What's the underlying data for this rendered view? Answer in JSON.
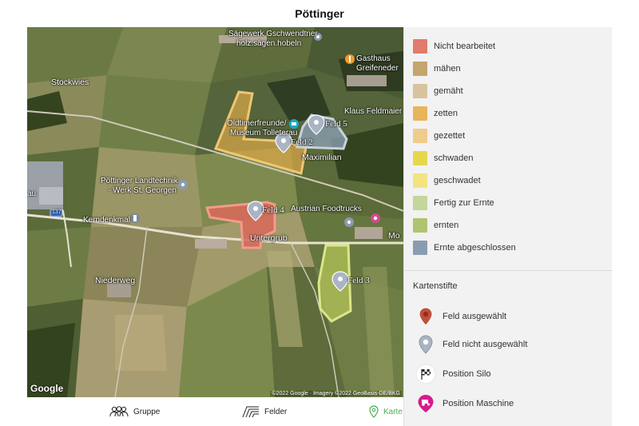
{
  "header": {
    "title": "Pöttinger"
  },
  "map": {
    "labels": {
      "stockwies": "Stockwies",
      "sagewerk_line1": "Sägewerk Gschwendtner",
      "sagewerk_line2": "holz.sägen.hobeln",
      "gasthaus_line1": "Gasthaus",
      "gasthaus_line2": "Greifeneder",
      "klaus": "Klaus Feldmaier",
      "oldtimer_line1": "Oldtimerfreunde/",
      "oldtimer_line2": "Museum Tolleterau",
      "maximilian": "Maximilian",
      "landtechnik_line1": "Pöttinger Landtechnik",
      "landtechnik_line2": "- Werk St. Georgen",
      "kerndenkmal": "Kerndenkmal",
      "austrian": "Austrian Foodtrucks",
      "untergrub": "Untergrub",
      "niederweg": "Niederweg",
      "mo": "Mo",
      "road_137": "137",
      "au": "au"
    },
    "fields": {
      "feld2": "Feld 2",
      "feld3": "Feld 3",
      "feld4": "Feld 4",
      "feld5": "Feld 5"
    },
    "google": "Google",
    "copyright": "©2022 Google · Imagery ©2022 GeoBasis-DE/BKG"
  },
  "legend": {
    "items": [
      {
        "label": "Nicht bearbeitet",
        "color": "#e07b6e"
      },
      {
        "label": "mähen",
        "color": "#c4a66c"
      },
      {
        "label": "gemäht",
        "color": "#d8c49c"
      },
      {
        "label": "zetten",
        "color": "#e8b55a"
      },
      {
        "label": "gezettet",
        "color": "#f0cc8a"
      },
      {
        "label": "schwaden",
        "color": "#e6d84a"
      },
      {
        "label": "geschwadet",
        "color": "#f2e482"
      },
      {
        "label": "Fertig zur Ernte",
        "color": "#c4d69a"
      },
      {
        "label": "ernten",
        "color": "#aec470"
      },
      {
        "label": "Ernte abgeschlossen",
        "color": "#8a9db0"
      }
    ],
    "pins_title": "Kartenstifte",
    "pins": [
      {
        "label": "Feld ausgewählt",
        "icon": "pin-selected-icon",
        "color": "#c0503a"
      },
      {
        "label": "Feld nicht ausgewählt",
        "icon": "pin-unselected-icon",
        "color": "#aab4c4"
      },
      {
        "label": "Position Silo",
        "icon": "checkered-flag-icon",
        "color": "#222222"
      },
      {
        "label": "Position Maschine",
        "icon": "tractor-pin-icon",
        "color": "#d81b8c"
      }
    ]
  },
  "tabs": [
    {
      "label": "Gruppe",
      "icon": "group-icon"
    },
    {
      "label": "Felder",
      "icon": "fields-icon"
    },
    {
      "label": "Karte",
      "icon": "map-pin-icon",
      "active": true
    }
  ]
}
